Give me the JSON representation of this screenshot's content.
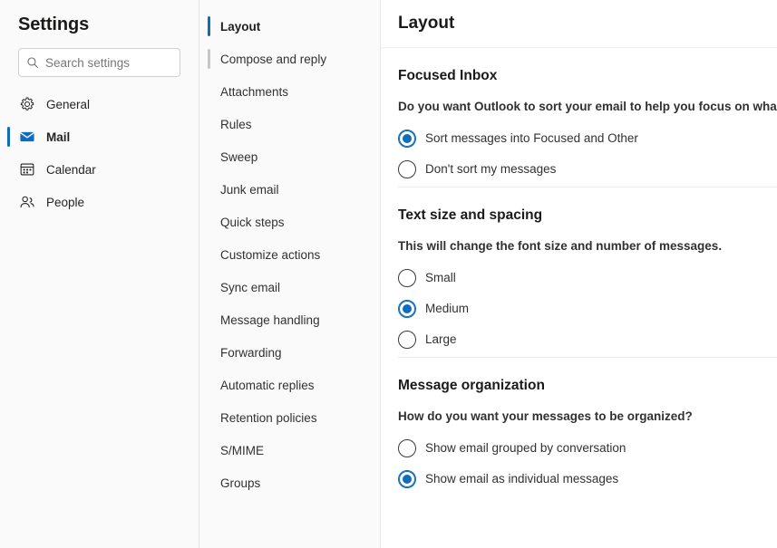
{
  "sidebar": {
    "title": "Settings",
    "search": {
      "placeholder": "Search settings",
      "value": "",
      "icon": "search-icon"
    },
    "items": [
      {
        "label": "General",
        "icon": "gear-icon",
        "selected": false
      },
      {
        "label": "Mail",
        "icon": "envelope-icon",
        "selected": true
      },
      {
        "label": "Calendar",
        "icon": "calendar-icon",
        "selected": false
      },
      {
        "label": "People",
        "icon": "people-icon",
        "selected": false
      }
    ]
  },
  "subnav": {
    "items": [
      {
        "label": "Layout",
        "selected": true,
        "hover": false
      },
      {
        "label": "Compose and reply",
        "selected": false,
        "hover": true
      },
      {
        "label": "Attachments",
        "selected": false,
        "hover": false
      },
      {
        "label": "Rules",
        "selected": false,
        "hover": false
      },
      {
        "label": "Sweep",
        "selected": false,
        "hover": false
      },
      {
        "label": "Junk email",
        "selected": false,
        "hover": false
      },
      {
        "label": "Quick steps",
        "selected": false,
        "hover": false
      },
      {
        "label": "Customize actions",
        "selected": false,
        "hover": false
      },
      {
        "label": "Sync email",
        "selected": false,
        "hover": false
      },
      {
        "label": "Message handling",
        "selected": false,
        "hover": false
      },
      {
        "label": "Forwarding",
        "selected": false,
        "hover": false
      },
      {
        "label": "Automatic replies",
        "selected": false,
        "hover": false
      },
      {
        "label": "Retention policies",
        "selected": false,
        "hover": false
      },
      {
        "label": "S/MIME",
        "selected": false,
        "hover": false
      },
      {
        "label": "Groups",
        "selected": false,
        "hover": false
      }
    ]
  },
  "main": {
    "title": "Layout",
    "sections": [
      {
        "title": "Focused Inbox",
        "description": "Do you want Outlook to sort your email to help you focus on wha",
        "options": [
          {
            "label": "Sort messages into Focused and Other",
            "checked": true
          },
          {
            "label": "Don't sort my messages",
            "checked": false
          }
        ]
      },
      {
        "title": "Text size and spacing",
        "description": "This will change the font size and number of messages.",
        "options": [
          {
            "label": "Small",
            "checked": false
          },
          {
            "label": "Medium",
            "checked": true
          },
          {
            "label": "Large",
            "checked": false
          }
        ]
      },
      {
        "title": "Message organization",
        "description": "How do you want your messages to be organized?",
        "options": [
          {
            "label": "Show email grouped by conversation",
            "checked": false
          },
          {
            "label": "Show email as individual messages",
            "checked": true
          }
        ]
      }
    ]
  },
  "colors": {
    "accent": "#0f6cbd",
    "text": "#323130",
    "heading": "#1b1a19",
    "panel_bg": "#fafafa",
    "divider": "#edebe9"
  }
}
